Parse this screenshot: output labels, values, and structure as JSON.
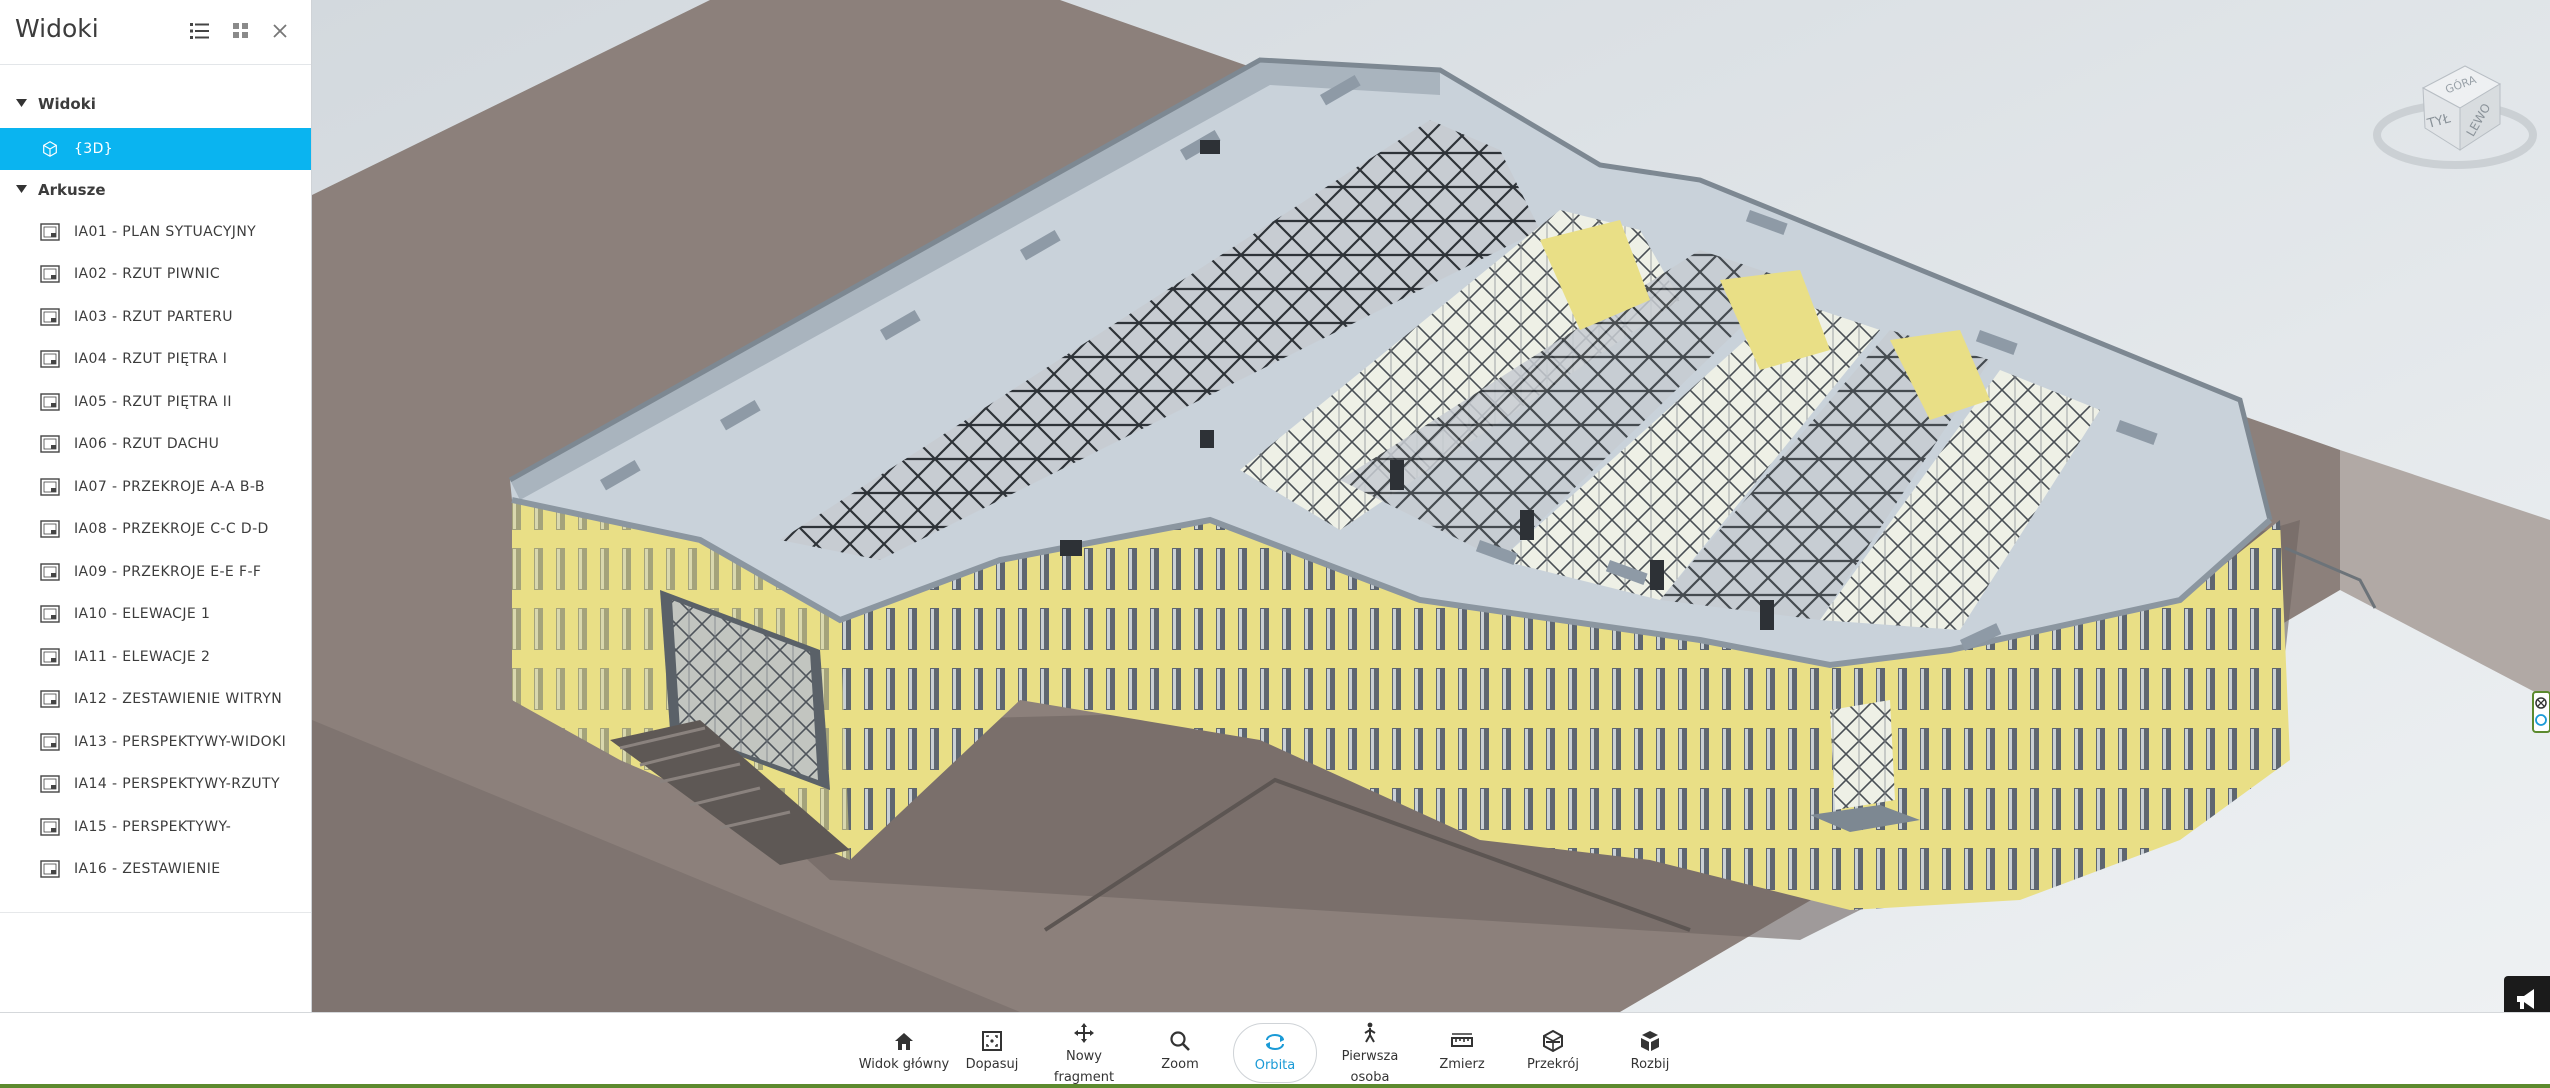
{
  "sidebar": {
    "title": "Widoki",
    "sections": {
      "views_label": "Widoki",
      "sheets_label": "Arkusze"
    },
    "views": [
      {
        "label": "{3D}",
        "selected": true
      }
    ],
    "sheets": [
      {
        "label": "IA01 - PLAN SYTUACYJNY"
      },
      {
        "label": "IA02 - RZUT PIWNIC"
      },
      {
        "label": "IA03 - RZUT PARTERU"
      },
      {
        "label": "IA04 - RZUT PIĘTRA I"
      },
      {
        "label": "IA05 - RZUT PIĘTRA II"
      },
      {
        "label": "IA06 - RZUT DACHU"
      },
      {
        "label": "IA07 - PRZEKROJE A-A B-B"
      },
      {
        "label": "IA08 - PRZEKROJE C-C D-D"
      },
      {
        "label": "IA09 - PRZEKROJE E-E F-F"
      },
      {
        "label": "IA10 - ELEWACJE 1"
      },
      {
        "label": "IA11 - ELEWACJE 2"
      },
      {
        "label": "IA12 - ZESTAWIENIE WITRYN"
      },
      {
        "label": "IA13 - PERSPEKTYWY-WIDOKI"
      },
      {
        "label": "IA14 - PERSPEKTYWY-RZUTY"
      },
      {
        "label": "IA15 - PERSPEKTYWY-"
      },
      {
        "label": "IA16 - ZESTAWIENIE"
      }
    ]
  },
  "viewcube": {
    "faces": {
      "top": "GÓRA",
      "back": "TYŁ",
      "left": "LEWO"
    }
  },
  "toolbar": {
    "tools": [
      {
        "label": "Widok główny",
        "icon": "home-icon"
      },
      {
        "label": "Dopasuj",
        "icon": "fit-icon"
      },
      {
        "label": "Nowy fragment",
        "icon": "pan-icon"
      },
      {
        "label": "Zoom",
        "icon": "zoom-icon"
      },
      {
        "label": "Orbita",
        "icon": "orbit-icon",
        "active": true
      },
      {
        "label": "Pierwsza osoba",
        "icon": "first-person-icon"
      },
      {
        "label": "Zmierz",
        "icon": "measure-icon"
      },
      {
        "label": "Przekrój",
        "icon": "section-icon"
      },
      {
        "label": "Rozbij",
        "icon": "explode-icon"
      }
    ]
  },
  "colors": {
    "accent": "#0ab4f0",
    "active_tool": "#1a9ad6",
    "facade": "#e8df84",
    "roof": "#c9d2da",
    "ground": "#8c807b"
  }
}
